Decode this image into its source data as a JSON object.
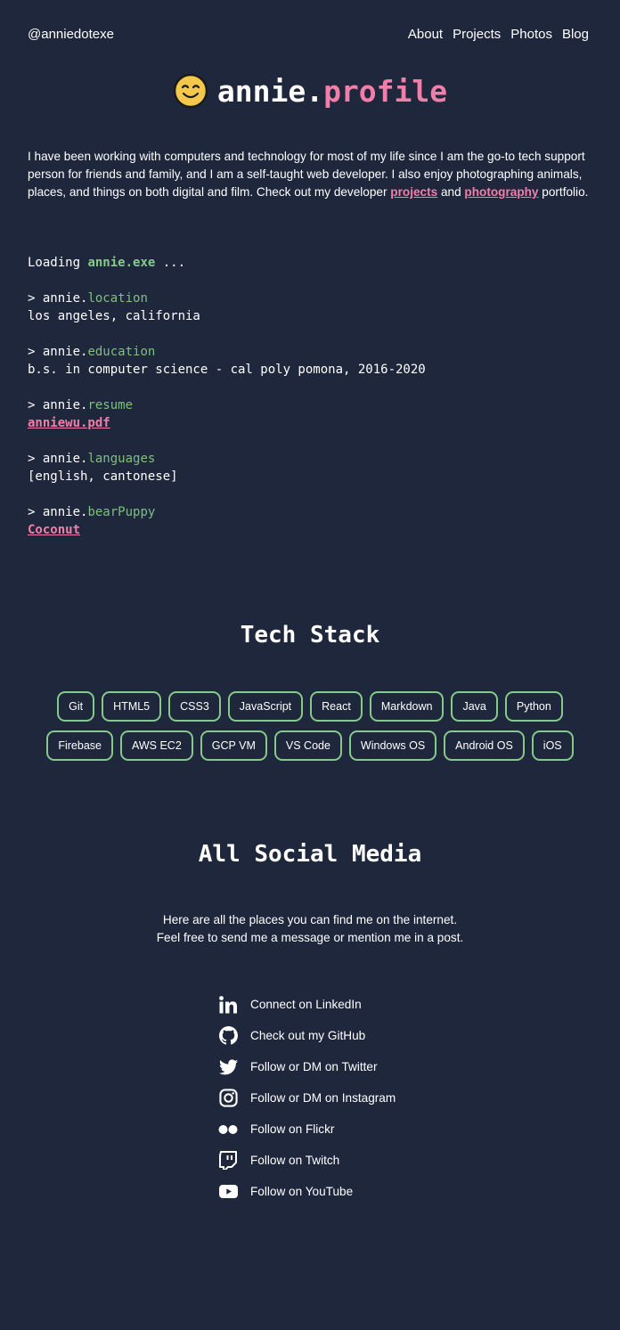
{
  "header": {
    "handle": "@anniedotexe",
    "nav": [
      "About",
      "Projects",
      "Photos",
      "Blog"
    ]
  },
  "hero": {
    "brand_prefix": "annie",
    "brand_dot": ".",
    "brand_accent": "profile"
  },
  "bio": {
    "text_1": "I have been working with computers and technology for most of my life since I am the go-to tech support person for friends and family, and I am a self-taught web developer. I also enjoy photographing animals, places, and things on both digital and film. Check out my developer ",
    "link_projects": "projects",
    "text_2": " and ",
    "link_photography": "photography",
    "text_3": " portfolio."
  },
  "terminal": {
    "loading_prefix": "Loading ",
    "loading_file": "annie.exe",
    "loading_suffix": " ...",
    "prompt": "> annie.",
    "entries": [
      {
        "key": "location",
        "value": "los angeles, california"
      },
      {
        "key": "education",
        "value": "b.s. in computer science - cal poly pomona, 2016-2020"
      },
      {
        "key": "resume",
        "value": "anniewu.pdf"
      },
      {
        "key": "languages",
        "value": "[english, cantonese]"
      },
      {
        "key": "bearPuppy",
        "value": "Coconut"
      }
    ]
  },
  "tech_stack": {
    "title": "Tech Stack",
    "row_1": [
      "Git",
      "HTML5",
      "CSS3",
      "JavaScript",
      "React",
      "Markdown",
      "Java",
      "Python"
    ],
    "row_2": [
      "Firebase",
      "AWS EC2",
      "GCP VM",
      "VS Code",
      "Windows OS",
      "Android OS",
      "iOS"
    ]
  },
  "social": {
    "title": "All Social Media",
    "desc_1": "Here are all the places you can find me on the internet.",
    "desc_2": "Feel free to send me a message or mention me in a post.",
    "links": [
      {
        "icon": "linkedin-icon",
        "label": "Connect on LinkedIn"
      },
      {
        "icon": "github-icon",
        "label": "Check out my GitHub"
      },
      {
        "icon": "twitter-icon",
        "label": "Follow or DM on Twitter"
      },
      {
        "icon": "instagram-icon",
        "label": "Follow or DM on Instagram"
      },
      {
        "icon": "flickr-icon",
        "label": "Follow on Flickr"
      },
      {
        "icon": "twitch-icon",
        "label": "Follow on Twitch"
      },
      {
        "icon": "youtube-icon",
        "label": "Follow on YouTube"
      }
    ]
  },
  "colors": {
    "background": "#1f273d",
    "accent_pink": "#f17fa9",
    "accent_green": "#86c98a",
    "smiley_yellow": "#f3c84b"
  }
}
